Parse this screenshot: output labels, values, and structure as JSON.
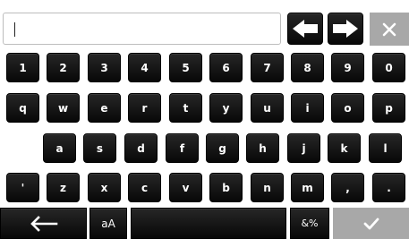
{
  "input": {
    "value": ""
  },
  "rows": {
    "numbers": [
      "1",
      "2",
      "3",
      "4",
      "5",
      "6",
      "7",
      "8",
      "9",
      "0"
    ],
    "row1": [
      "q",
      "w",
      "e",
      "r",
      "t",
      "y",
      "u",
      "i",
      "o",
      "p"
    ],
    "row2": [
      "a",
      "s",
      "d",
      "f",
      "g",
      "h",
      "j",
      "k",
      "l"
    ],
    "row3": [
      "'",
      "z",
      "x",
      "c",
      "v",
      "b",
      "n",
      "m",
      ",",
      "."
    ]
  },
  "bottom": {
    "case_label": "aA",
    "symbols_label": "&%"
  },
  "icons": {
    "cursor_left": "arrow-left-icon",
    "cursor_right": "arrow-right-icon",
    "clear": "close-icon",
    "backspace": "backspace-arrow-icon",
    "confirm": "checkmark-icon"
  }
}
